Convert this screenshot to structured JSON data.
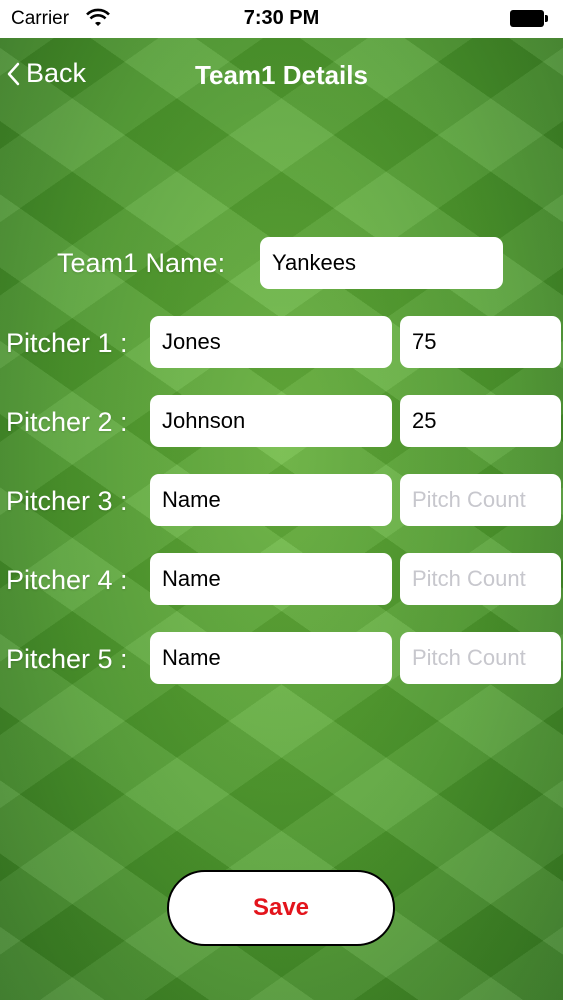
{
  "status_bar": {
    "carrier": "Carrier",
    "time": "7:30 PM"
  },
  "nav": {
    "back_label": "Back",
    "title": "Team1 Details"
  },
  "team": {
    "label": "Team1 Name:",
    "value": "Yankees"
  },
  "pitchers": [
    {
      "label": "Pitcher 1 :",
      "name": "Jones",
      "count": "75"
    },
    {
      "label": "Pitcher 2 :",
      "name": "Johnson",
      "count": "25"
    },
    {
      "label": "Pitcher 3 :",
      "name": "Name",
      "count": "Pitch Count"
    },
    {
      "label": "Pitcher 4 :",
      "name": "Name",
      "count": "Pitch Count"
    },
    {
      "label": "Pitcher 5 :",
      "name": "Name",
      "count": "Pitch Count"
    }
  ],
  "save_label": "Save",
  "colors": {
    "accent_red": "#e3141c",
    "field_bg": "#ffffff",
    "grass": "#4e9a2f",
    "placeholder": "#c7c7cd"
  },
  "icons": [
    "wifi-icon",
    "battery-icon",
    "chevron-left-icon"
  ]
}
